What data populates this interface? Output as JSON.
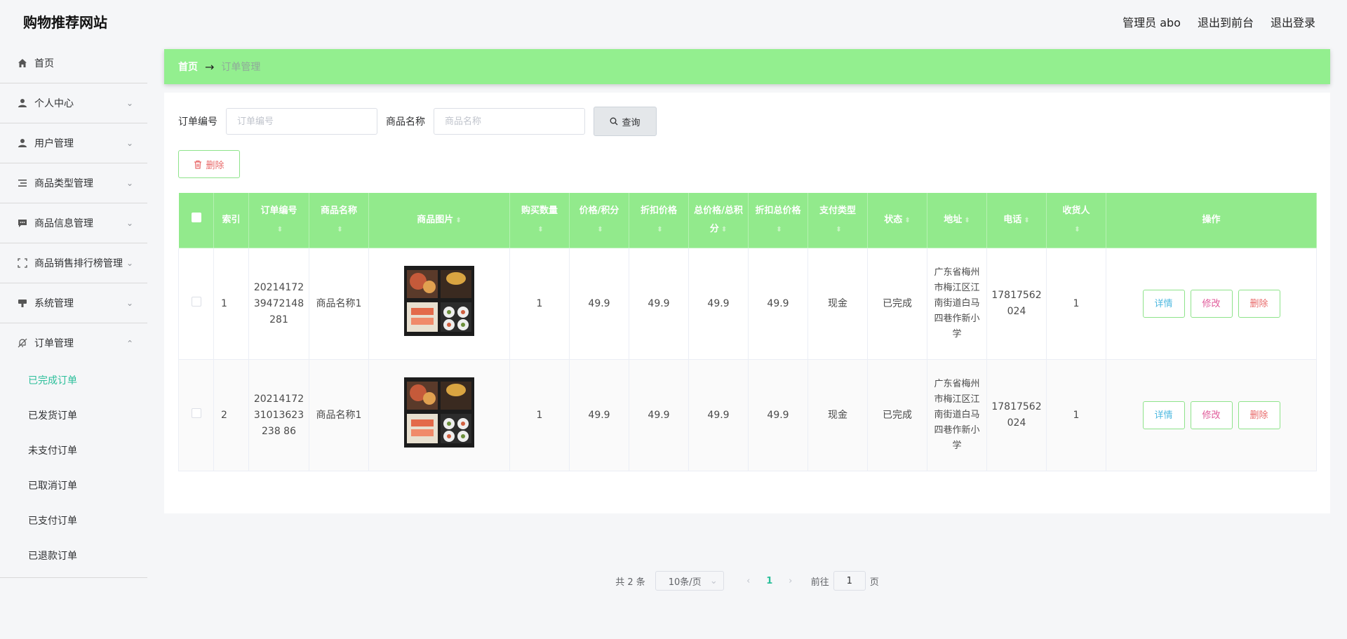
{
  "header": {
    "site_title": "购物推荐网站",
    "admin_label": "管理员 abo",
    "front_link": "退出到前台",
    "logout_link": "退出登录"
  },
  "sidebar": {
    "items": [
      {
        "label": "首页",
        "icon": "home-icon"
      },
      {
        "label": "个人中心",
        "icon": "user-icon"
      },
      {
        "label": "用户管理",
        "icon": "user-icon"
      },
      {
        "label": "商品类型管理",
        "icon": "list-icon"
      },
      {
        "label": "商品信息管理",
        "icon": "message-icon"
      },
      {
        "label": "商品销售排行榜管理",
        "icon": "fullscreen-icon"
      },
      {
        "label": "系统管理",
        "icon": "settings-icon"
      },
      {
        "label": "订单管理",
        "icon": "bell-off-icon"
      }
    ],
    "sub_items": [
      {
        "label": "已完成订单",
        "active": true
      },
      {
        "label": "已发货订单"
      },
      {
        "label": "未支付订单"
      },
      {
        "label": "已取消订单"
      },
      {
        "label": "已支付订单"
      },
      {
        "label": "已退款订单"
      }
    ]
  },
  "breadcrumb": {
    "home": "首页",
    "separator": "→",
    "current": "订单管理"
  },
  "filter": {
    "order_no_label": "订单编号",
    "order_no_placeholder": "订单编号",
    "product_name_label": "商品名称",
    "product_name_placeholder": "商品名称",
    "query_button": "查询"
  },
  "delete_button": "删除",
  "table": {
    "columns": [
      "索引",
      "订单编号",
      "商品名称",
      "商品图片",
      "购买数量",
      "价格/积分",
      "折扣价格",
      "总价格/总积分",
      "折扣总价格",
      "支付类型",
      "状态",
      "地址",
      "电话",
      "收货人",
      "操作"
    ],
    "rows": [
      {
        "index": "1",
        "order_no": "2021417239472148281",
        "product_name": "商品名称1",
        "quantity": "1",
        "price": "49.9",
        "discount_price": "49.9",
        "total_price": "49.9",
        "discount_total": "49.9",
        "pay_type": "现金",
        "status": "已完成",
        "address": "广东省梅州市梅江区江南街道白马四巷作新小学",
        "phone": "17817562024",
        "receiver": "1"
      },
      {
        "index": "2",
        "order_no": "2021417231013623238 86",
        "product_name": "商品名称1",
        "quantity": "1",
        "price": "49.9",
        "discount_price": "49.9",
        "total_price": "49.9",
        "discount_total": "49.9",
        "pay_type": "现金",
        "status": "已完成",
        "address": "广东省梅州市梅江区江南街道白马四巷作新小学",
        "phone": "17817562024",
        "receiver": "1"
      }
    ],
    "op_labels": {
      "detail": "详情",
      "edit": "修改",
      "delete": "删除"
    }
  },
  "pagination": {
    "total": "共 2 条",
    "page_size": "10条/页",
    "current_page": "1",
    "goto_prefix": "前往",
    "goto_value": "1",
    "goto_suffix": "页"
  },
  "colors": {
    "accent": "#93ef8f",
    "active_text": "#2bbf9a"
  }
}
